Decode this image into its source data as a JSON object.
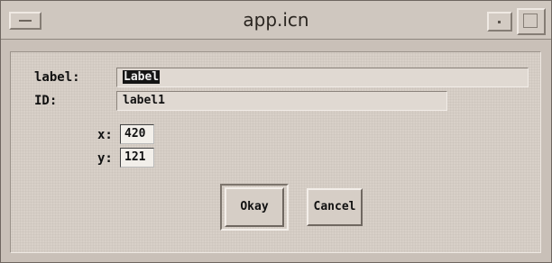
{
  "window": {
    "title": "app.icn"
  },
  "form": {
    "label_caption": "label:",
    "label_value": "Label",
    "id_caption": "ID:",
    "id_value": "label1",
    "x_caption": "x:",
    "x_value": "420",
    "y_caption": "y:",
    "y_value": "121"
  },
  "buttons": {
    "okay_label": "Okay",
    "cancel_label": "Cancel"
  },
  "icons": {
    "window_menu": "window-menu-icon",
    "minimize": "minimize-icon",
    "maximize": "maximize-icon"
  }
}
